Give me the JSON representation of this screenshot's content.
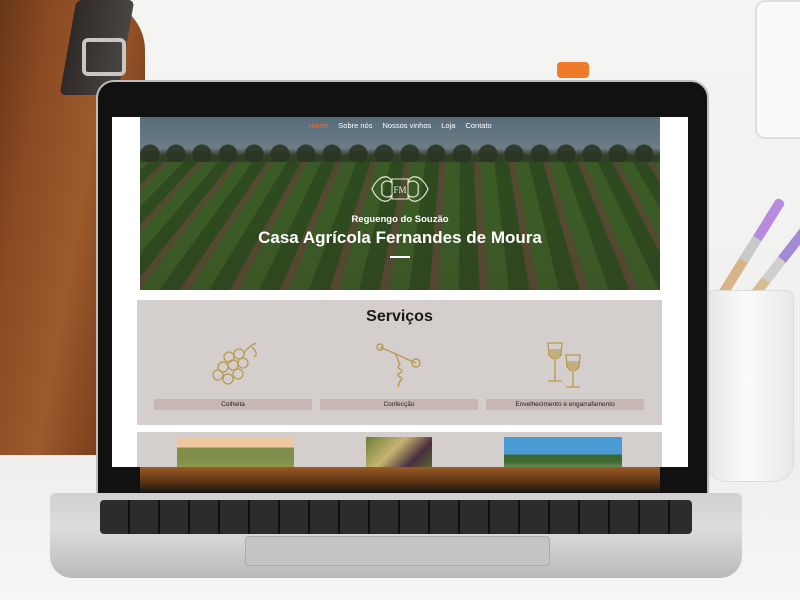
{
  "site": {
    "nav": [
      {
        "label": "Home",
        "active": true
      },
      {
        "label": "Sobre nós",
        "active": false
      },
      {
        "label": "Nossos vinhos",
        "active": false
      },
      {
        "label": "Loja",
        "active": false
      },
      {
        "label": "Contato",
        "active": false
      }
    ],
    "hero": {
      "logo_text": "FM",
      "subtitle": "Reguengo do Souzão",
      "title": "Casa Agrícola Fernandes de Moura"
    },
    "services": {
      "heading": "Serviços",
      "items": [
        {
          "label": "Colheita",
          "icon": "grapes-icon"
        },
        {
          "label": "Confecção",
          "icon": "corkscrew-icon"
        },
        {
          "label": "Envelhecimento e engarrafamento",
          "icon": "wine-glasses-icon"
        }
      ]
    },
    "gallery": [
      "vineyard-photo",
      "grapes-photo",
      "landscape-photo"
    ],
    "colors": {
      "accent": "#ef6a2e",
      "section_bg": "#d4cfcc",
      "label_bg": "#c7b6b3",
      "icon_gold": "#b99a4e"
    }
  }
}
